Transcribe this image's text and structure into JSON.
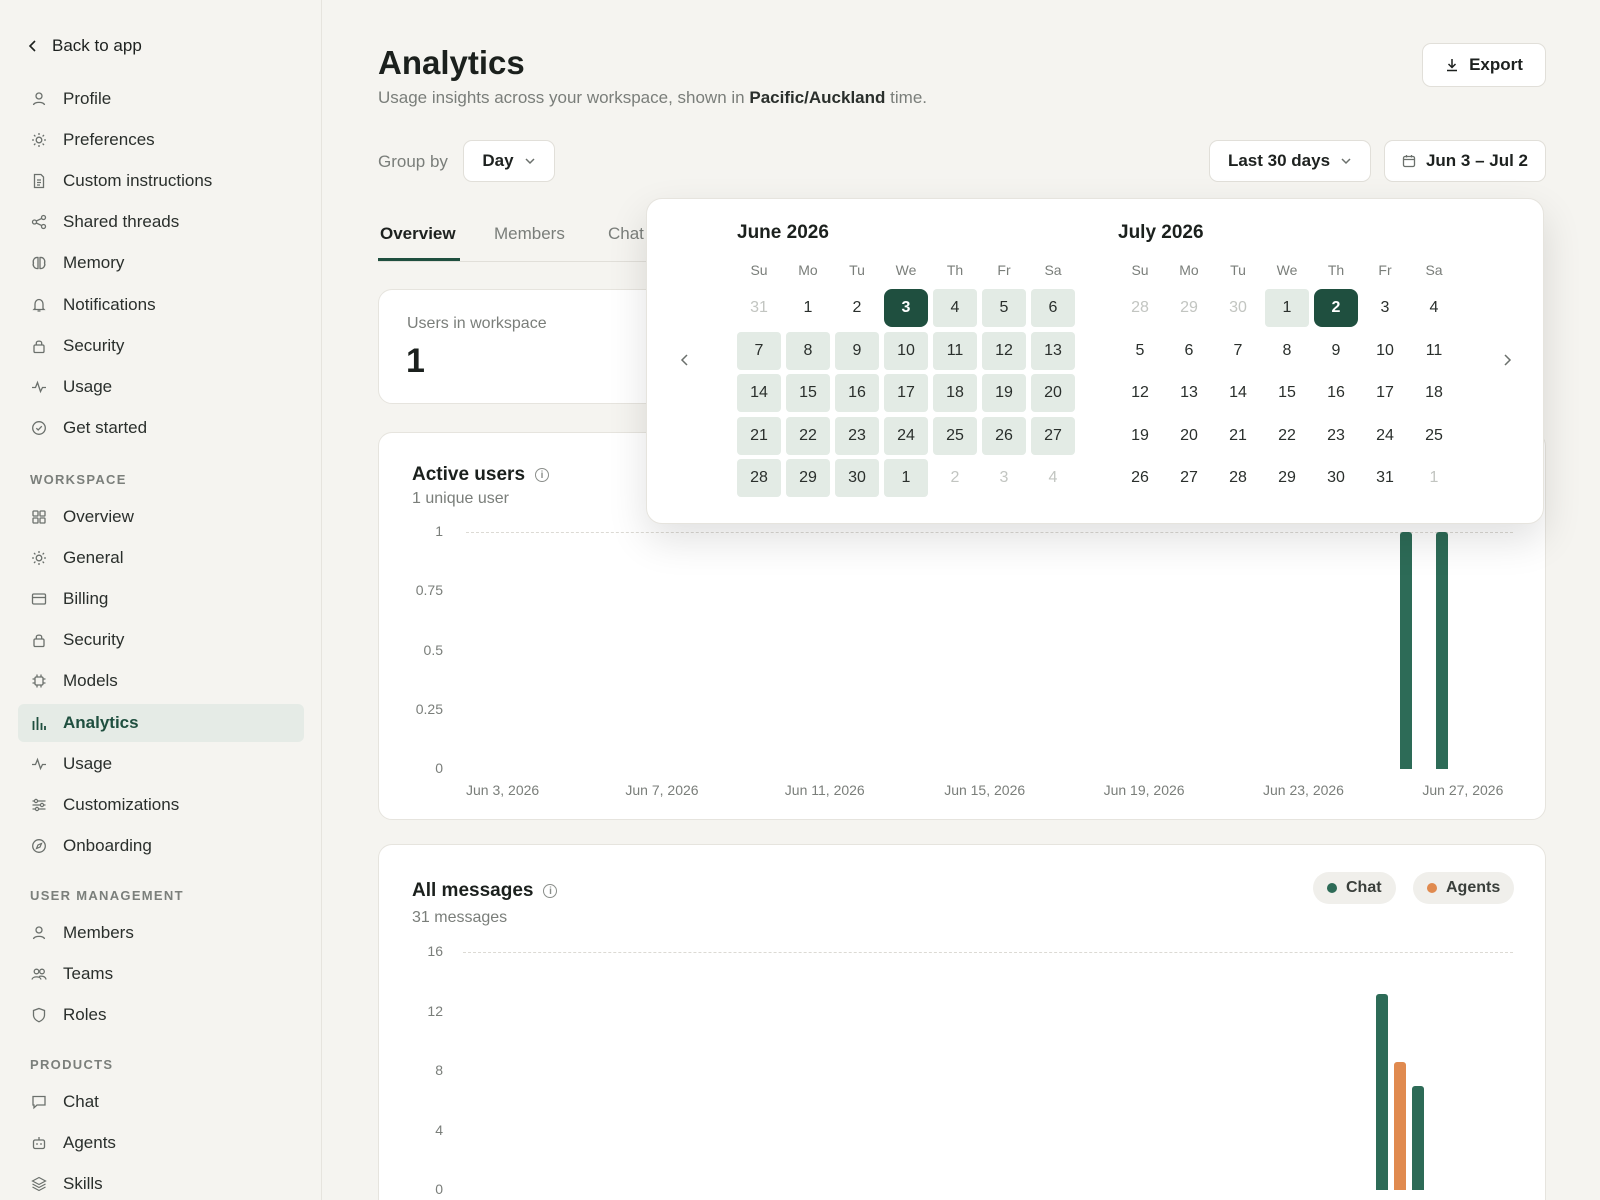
{
  "sidebar": {
    "back_label": "Back to app",
    "top_items": [
      {
        "label": "Profile",
        "icon": "user-icon"
      },
      {
        "label": "Preferences",
        "icon": "sun-icon"
      },
      {
        "label": "Custom instructions",
        "icon": "document-icon"
      },
      {
        "label": "Shared threads",
        "icon": "share-icon"
      },
      {
        "label": "Memory",
        "icon": "brain-icon"
      },
      {
        "label": "Notifications",
        "icon": "bell-icon"
      },
      {
        "label": "Security",
        "icon": "lock-icon"
      },
      {
        "label": "Usage",
        "icon": "activity-icon"
      },
      {
        "label": "Get started",
        "icon": "check-circle-icon"
      }
    ],
    "workspace_heading": "WORKSPACE",
    "workspace_items": [
      {
        "label": "Overview",
        "icon": "grid-icon"
      },
      {
        "label": "General",
        "icon": "sun-icon"
      },
      {
        "label": "Billing",
        "icon": "card-icon"
      },
      {
        "label": "Security",
        "icon": "lock-icon"
      },
      {
        "label": "Models",
        "icon": "chip-icon"
      },
      {
        "label": "Analytics",
        "icon": "bar-chart-icon",
        "active": true
      },
      {
        "label": "Usage",
        "icon": "activity-icon"
      },
      {
        "label": "Customizations",
        "icon": "sliders-icon"
      },
      {
        "label": "Onboarding",
        "icon": "compass-icon"
      }
    ],
    "user_mgmt_heading": "USER MANAGEMENT",
    "user_mgmt_items": [
      {
        "label": "Members",
        "icon": "user-icon"
      },
      {
        "label": "Teams",
        "icon": "users-icon"
      },
      {
        "label": "Roles",
        "icon": "shield-icon"
      }
    ],
    "products_heading": "PRODUCTS",
    "products_items": [
      {
        "label": "Chat",
        "icon": "chat-icon"
      },
      {
        "label": "Agents",
        "icon": "robot-icon"
      },
      {
        "label": "Skills",
        "icon": "layers-icon"
      }
    ]
  },
  "header": {
    "title": "Analytics",
    "subtitle_prefix": "Usage insights across your workspace, shown in",
    "timezone": "Pacific/Auckland",
    "subtitle_suffix": "time.",
    "export_label": "Export"
  },
  "controls": {
    "group_by_label": "Group by",
    "group_by_value": "Day",
    "range_preset": "Last 30 days",
    "date_range": "Jun 3 – Jul 2"
  },
  "tabs": [
    "Overview",
    "Members",
    "Chat"
  ],
  "users_card": {
    "label": "Users in workspace",
    "value": "1"
  },
  "active_users": {
    "title": "Active users",
    "subtitle": "1 unique user"
  },
  "all_messages": {
    "title": "All messages",
    "subtitle": "31 messages",
    "legend": [
      {
        "name": "Chat",
        "color": "#2d6b57"
      },
      {
        "name": "Agents",
        "color": "#e08a4f"
      }
    ]
  },
  "colors": {
    "accent": "#1f4f3f",
    "chat": "#2d6b57",
    "agents": "#e08a4f"
  },
  "chart_data": [
    {
      "type": "bar",
      "title": "Active users",
      "y_ticks": [
        "1",
        "0.75",
        "0.5",
        "0.25",
        "0"
      ],
      "ylim": [
        0,
        1
      ],
      "x_tick_labels": [
        "Jun 3, 2026",
        "Jun 7, 2026",
        "Jun 11, 2026",
        "Jun 15, 2026",
        "Jun 19, 2026",
        "Jun 23, 2026",
        "Jun 27, 2026"
      ],
      "x_range": [
        "2026-06-03",
        "2026-07-02"
      ],
      "series": [
        {
          "values": [
            {
              "x": "2026-06-28",
              "y": 1
            },
            {
              "x": "2026-06-29",
              "y": 1
            }
          ]
        }
      ]
    },
    {
      "type": "bar",
      "title": "All messages",
      "y_ticks": [
        "16",
        "12",
        "8",
        "4",
        "0"
      ],
      "ylim": [
        0,
        16
      ],
      "x_range": [
        "2026-06-03",
        "2026-07-02"
      ],
      "series": [
        {
          "name": "Chat",
          "values": [
            {
              "x": "2026-06-28",
              "y": 13.2
            },
            {
              "x": "2026-06-29",
              "y": 7
            }
          ]
        },
        {
          "name": "Agents",
          "values": [
            {
              "x": "2026-06-28",
              "y": 8.6
            }
          ]
        }
      ]
    }
  ],
  "calendar": {
    "weekdays": [
      "Su",
      "Mo",
      "Tu",
      "We",
      "Th",
      "Fr",
      "Sa"
    ],
    "months": [
      {
        "title": "June 2026",
        "days": [
          [
            "31",
            "1",
            "2",
            "3",
            "4",
            "5",
            "6"
          ],
          [
            "7",
            "8",
            "9",
            "10",
            "11",
            "12",
            "13"
          ],
          [
            "14",
            "15",
            "16",
            "17",
            "18",
            "19",
            "20"
          ],
          [
            "21",
            "22",
            "23",
            "24",
            "25",
            "26",
            "27"
          ],
          [
            "28",
            "29",
            "30",
            "1",
            "2",
            "3",
            "4"
          ]
        ],
        "first_in_month_index": 1,
        "last_in_month_index": 31,
        "range_start": 3,
        "range_end": 34,
        "selected": [
          3
        ]
      },
      {
        "title": "July 2026",
        "days": [
          [
            "28",
            "29",
            "30",
            "1",
            "2",
            "3",
            "4"
          ],
          [
            "5",
            "6",
            "7",
            "8",
            "9",
            "10",
            "11"
          ],
          [
            "12",
            "13",
            "14",
            "15",
            "16",
            "17",
            "18"
          ],
          [
            "19",
            "20",
            "21",
            "22",
            "23",
            "24",
            "25"
          ],
          [
            "26",
            "27",
            "28",
            "29",
            "30",
            "31",
            "1"
          ]
        ],
        "first_in_month_index": 3,
        "last_in_month_index": 33,
        "range_start": 0,
        "range_end": 4,
        "selected": [
          4
        ]
      }
    ]
  }
}
